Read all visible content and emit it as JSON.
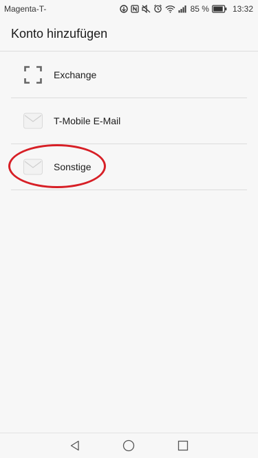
{
  "status_bar": {
    "carrier": "Magenta-T-",
    "battery_percent": "85 %",
    "time": "13:32",
    "icons": [
      "data-saver-icon",
      "nfc-icon",
      "mute-icon",
      "alarm-icon",
      "wifi-icon",
      "signal-icon",
      "battery-icon"
    ]
  },
  "header": {
    "title": "Konto hinzufügen"
  },
  "accounts": [
    {
      "label": "Exchange",
      "icon": "exchange-icon"
    },
    {
      "label": "T-Mobile E-Mail",
      "icon": "mail-icon"
    },
    {
      "label": "Sonstige",
      "icon": "mail-icon"
    }
  ],
  "highlight": {
    "color": "#d71f26",
    "target": "Sonstige"
  },
  "nav_bar": {
    "icons": [
      "back-icon",
      "home-icon",
      "recents-icon"
    ]
  }
}
